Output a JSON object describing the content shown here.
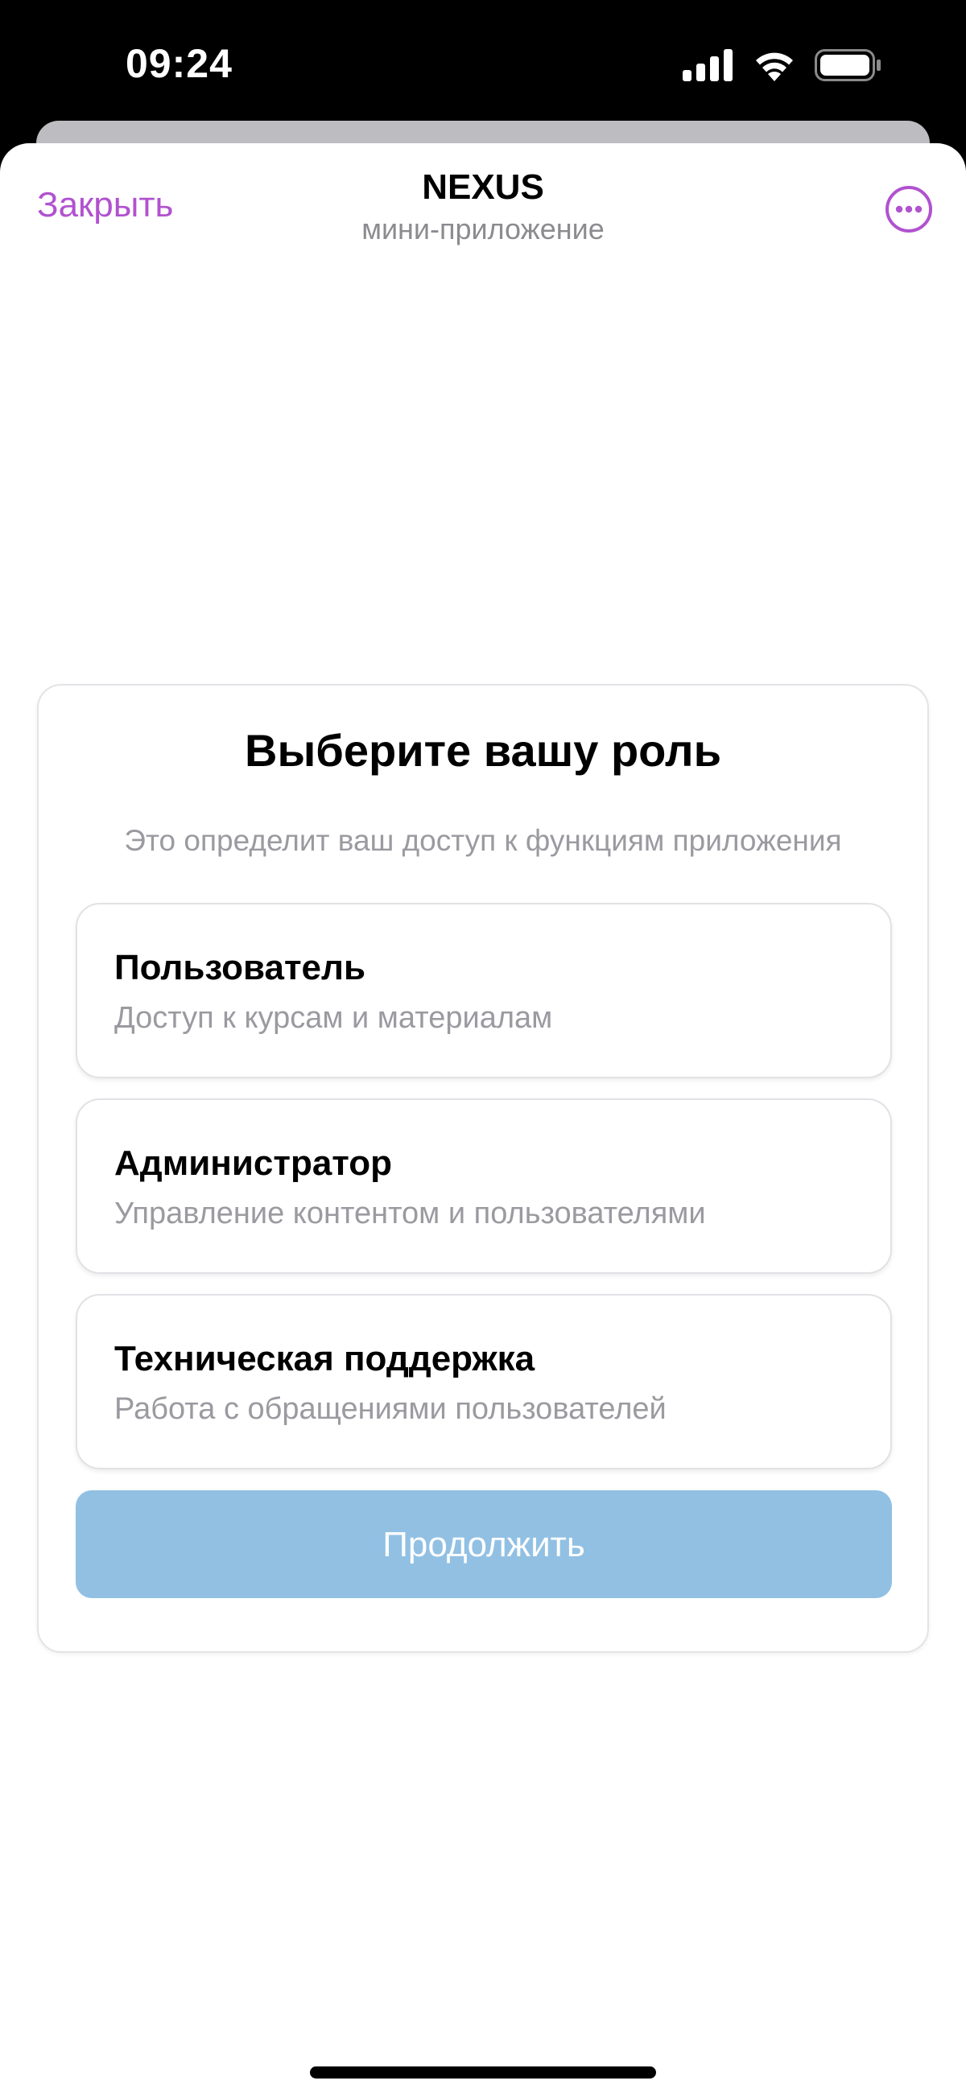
{
  "status_bar": {
    "time": "09:24",
    "icons": [
      "cellular-signal-icon",
      "wifi-icon",
      "battery-icon"
    ]
  },
  "header": {
    "close_label": "Закрыть",
    "title": "NEXUS",
    "subtitle": "мини-приложение",
    "more_icon": "more-horizontal-icon"
  },
  "role_card": {
    "title": "Выберите вашу роль",
    "subtitle": "Это определит ваш доступ к функциям приложения",
    "roles": [
      {
        "name": "Пользователь",
        "description": "Доступ к курсам и материалам"
      },
      {
        "name": "Администратор",
        "description": "Управление контентом и пользователями"
      },
      {
        "name": "Техническая поддержка",
        "description": "Работа с обращениями пользователей"
      }
    ],
    "continue_label": "Продолжить"
  },
  "colors": {
    "accent": "#b152cf",
    "button_disabled": "#91c0e3",
    "secondary_text": "#9a9aa0"
  }
}
